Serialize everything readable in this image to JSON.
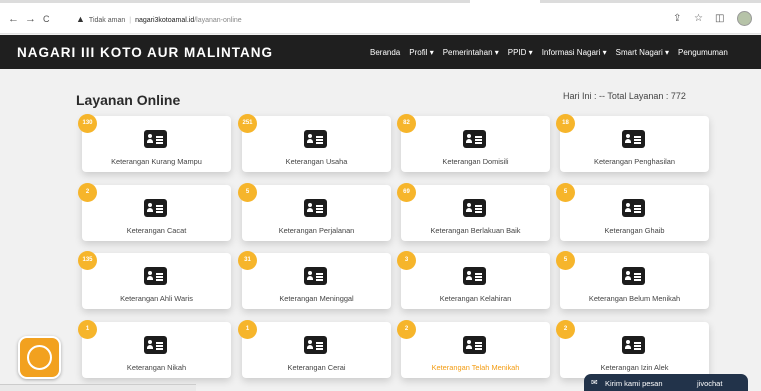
{
  "browser": {
    "back": "←",
    "forward": "→",
    "reload": "C",
    "security_icon": "▲",
    "security_text": "Tidak aman",
    "url_host": "nagari3kotoamal.id",
    "url_path": "/layanan-online",
    "share_icon": "⇪",
    "star_icon": "☆",
    "panel_icon": "◫"
  },
  "site": {
    "brand": "NAGARI III KOTO AUR MALINTANG",
    "menu": [
      "Beranda",
      "Profil ▾",
      "Pemerintahan ▾",
      "PPID ▾",
      "Informasi Nagari ▾",
      "Smart Nagari ▾",
      "Pengumuman"
    ]
  },
  "page": {
    "title": "Layanan Online",
    "stats": "Hari Ini : -- Total Layanan : 772"
  },
  "cards": [
    {
      "label": "Keterangan Kurang Mampu",
      "count": "130"
    },
    {
      "label": "Keterangan Usaha",
      "count": "251"
    },
    {
      "label": "Keterangan Domisili",
      "count": "82"
    },
    {
      "label": "Keterangan Penghasilan",
      "count": "18"
    },
    {
      "label": "Keterangan Cacat",
      "count": "2"
    },
    {
      "label": "Keterangan Perjalanan",
      "count": "5"
    },
    {
      "label": "Keterangan Berlakuan Baik",
      "count": "69"
    },
    {
      "label": "Keterangan Ghaib",
      "count": "5"
    },
    {
      "label": "Keterangan Ahli Waris",
      "count": "135"
    },
    {
      "label": "Keterangan Meninggal",
      "count": "31"
    },
    {
      "label": "Keterangan Kelahiran",
      "count": "3"
    },
    {
      "label": "Keterangan Belum Menikah",
      "count": "5"
    },
    {
      "label": "Keterangan Nikah",
      "count": "1"
    },
    {
      "label": "Keterangan Cerai",
      "count": "1"
    },
    {
      "label": "Keterangan Telah Menikah",
      "count": "2"
    },
    {
      "label": "Keterangan Izin Alek",
      "count": "2"
    }
  ],
  "chat": {
    "icon": "✉",
    "text": "Kirim kami pesan",
    "brand": "jivochat"
  },
  "colors": {
    "accent": "#f6b52b",
    "header_bg": "#1f1f1f",
    "highlight_label": "#f39c12",
    "chat_bg": "#22334a"
  }
}
